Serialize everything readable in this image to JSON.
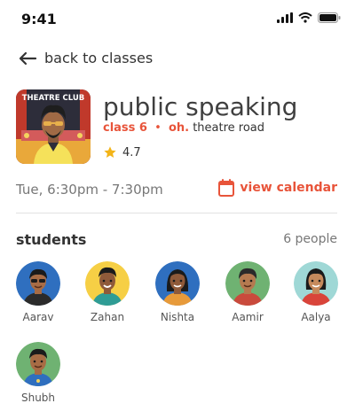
{
  "status_bar": {
    "time": "9:41"
  },
  "nav": {
    "back_label": "back to classes"
  },
  "class": {
    "thumb_sign": "THEATRE CLUB",
    "title": "public speaking",
    "grade": "class 6",
    "org": "oh.",
    "venue": "theatre road",
    "rating": "4.7",
    "schedule": "Tue, 6:30pm - 7:30pm",
    "view_calendar_label": "view calendar"
  },
  "students": {
    "title": "students",
    "count_label": "6 people",
    "list": [
      {
        "name": "Aarav",
        "bg": "#2f6fbf"
      },
      {
        "name": "Zahan",
        "bg": "#f6cf45"
      },
      {
        "name": "Nishta",
        "bg": "#2f6fbf"
      },
      {
        "name": "Aamir",
        "bg": "#6fb272"
      },
      {
        "name": "Aalya",
        "bg": "#9fd8d6"
      },
      {
        "name": "Shubh",
        "bg": "#6fb272"
      }
    ]
  },
  "colors": {
    "accent": "#e8543a",
    "star": "#f3b418"
  }
}
